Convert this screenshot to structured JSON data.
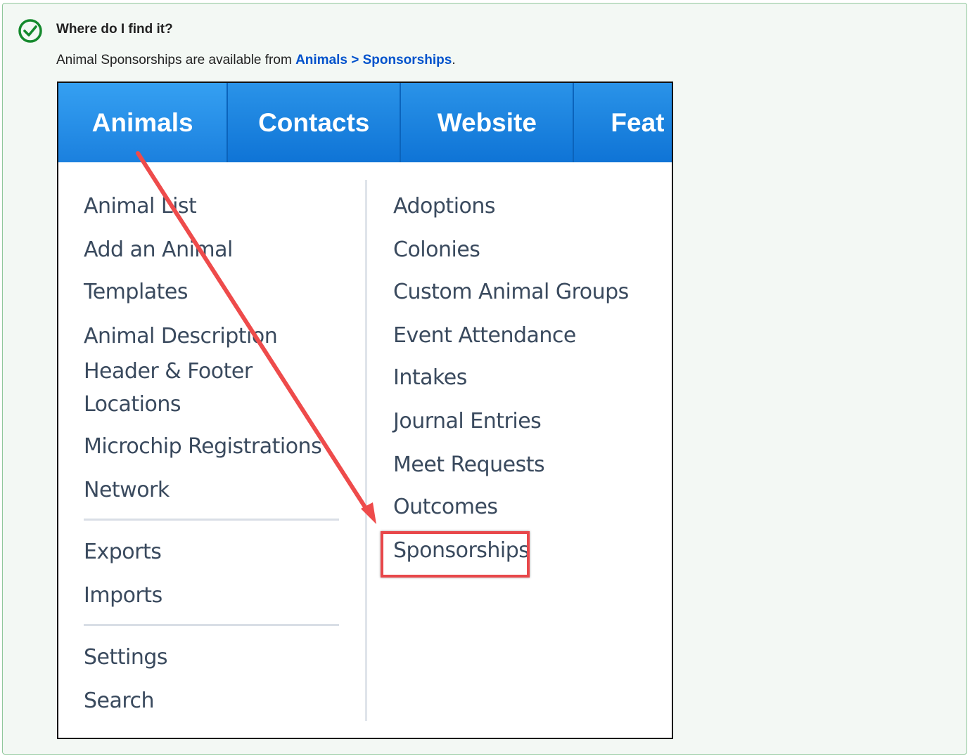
{
  "callout": {
    "title": "Where do I find it?",
    "text_before": "Animal Sponsorships are available from",
    "link": "Animals > Sponsorships",
    "text_after": ".",
    "icon": "check-circle-icon",
    "accent_color": "#14892c"
  },
  "nav": {
    "items": [
      "Animals",
      "Contacts",
      "Website",
      "Feat"
    ],
    "active": "Animals",
    "bar_color": "#1a7fde"
  },
  "menu": {
    "left": [
      "Animal List",
      "Add an Animal",
      "Templates",
      "Animal Description Header & Footer",
      "Locations",
      "Microchip Registrations",
      "Network",
      "Exports",
      "Imports",
      "Settings",
      "Search"
    ],
    "right": [
      "Adoptions",
      "Colonies",
      "Custom Animal Groups",
      "Event Attendance",
      "Intakes",
      "Journal Entries",
      "Meet Requests",
      "Outcomes",
      "Sponsorships"
    ],
    "highlighted": "Sponsorships",
    "highlight_color": "#e8474a"
  }
}
